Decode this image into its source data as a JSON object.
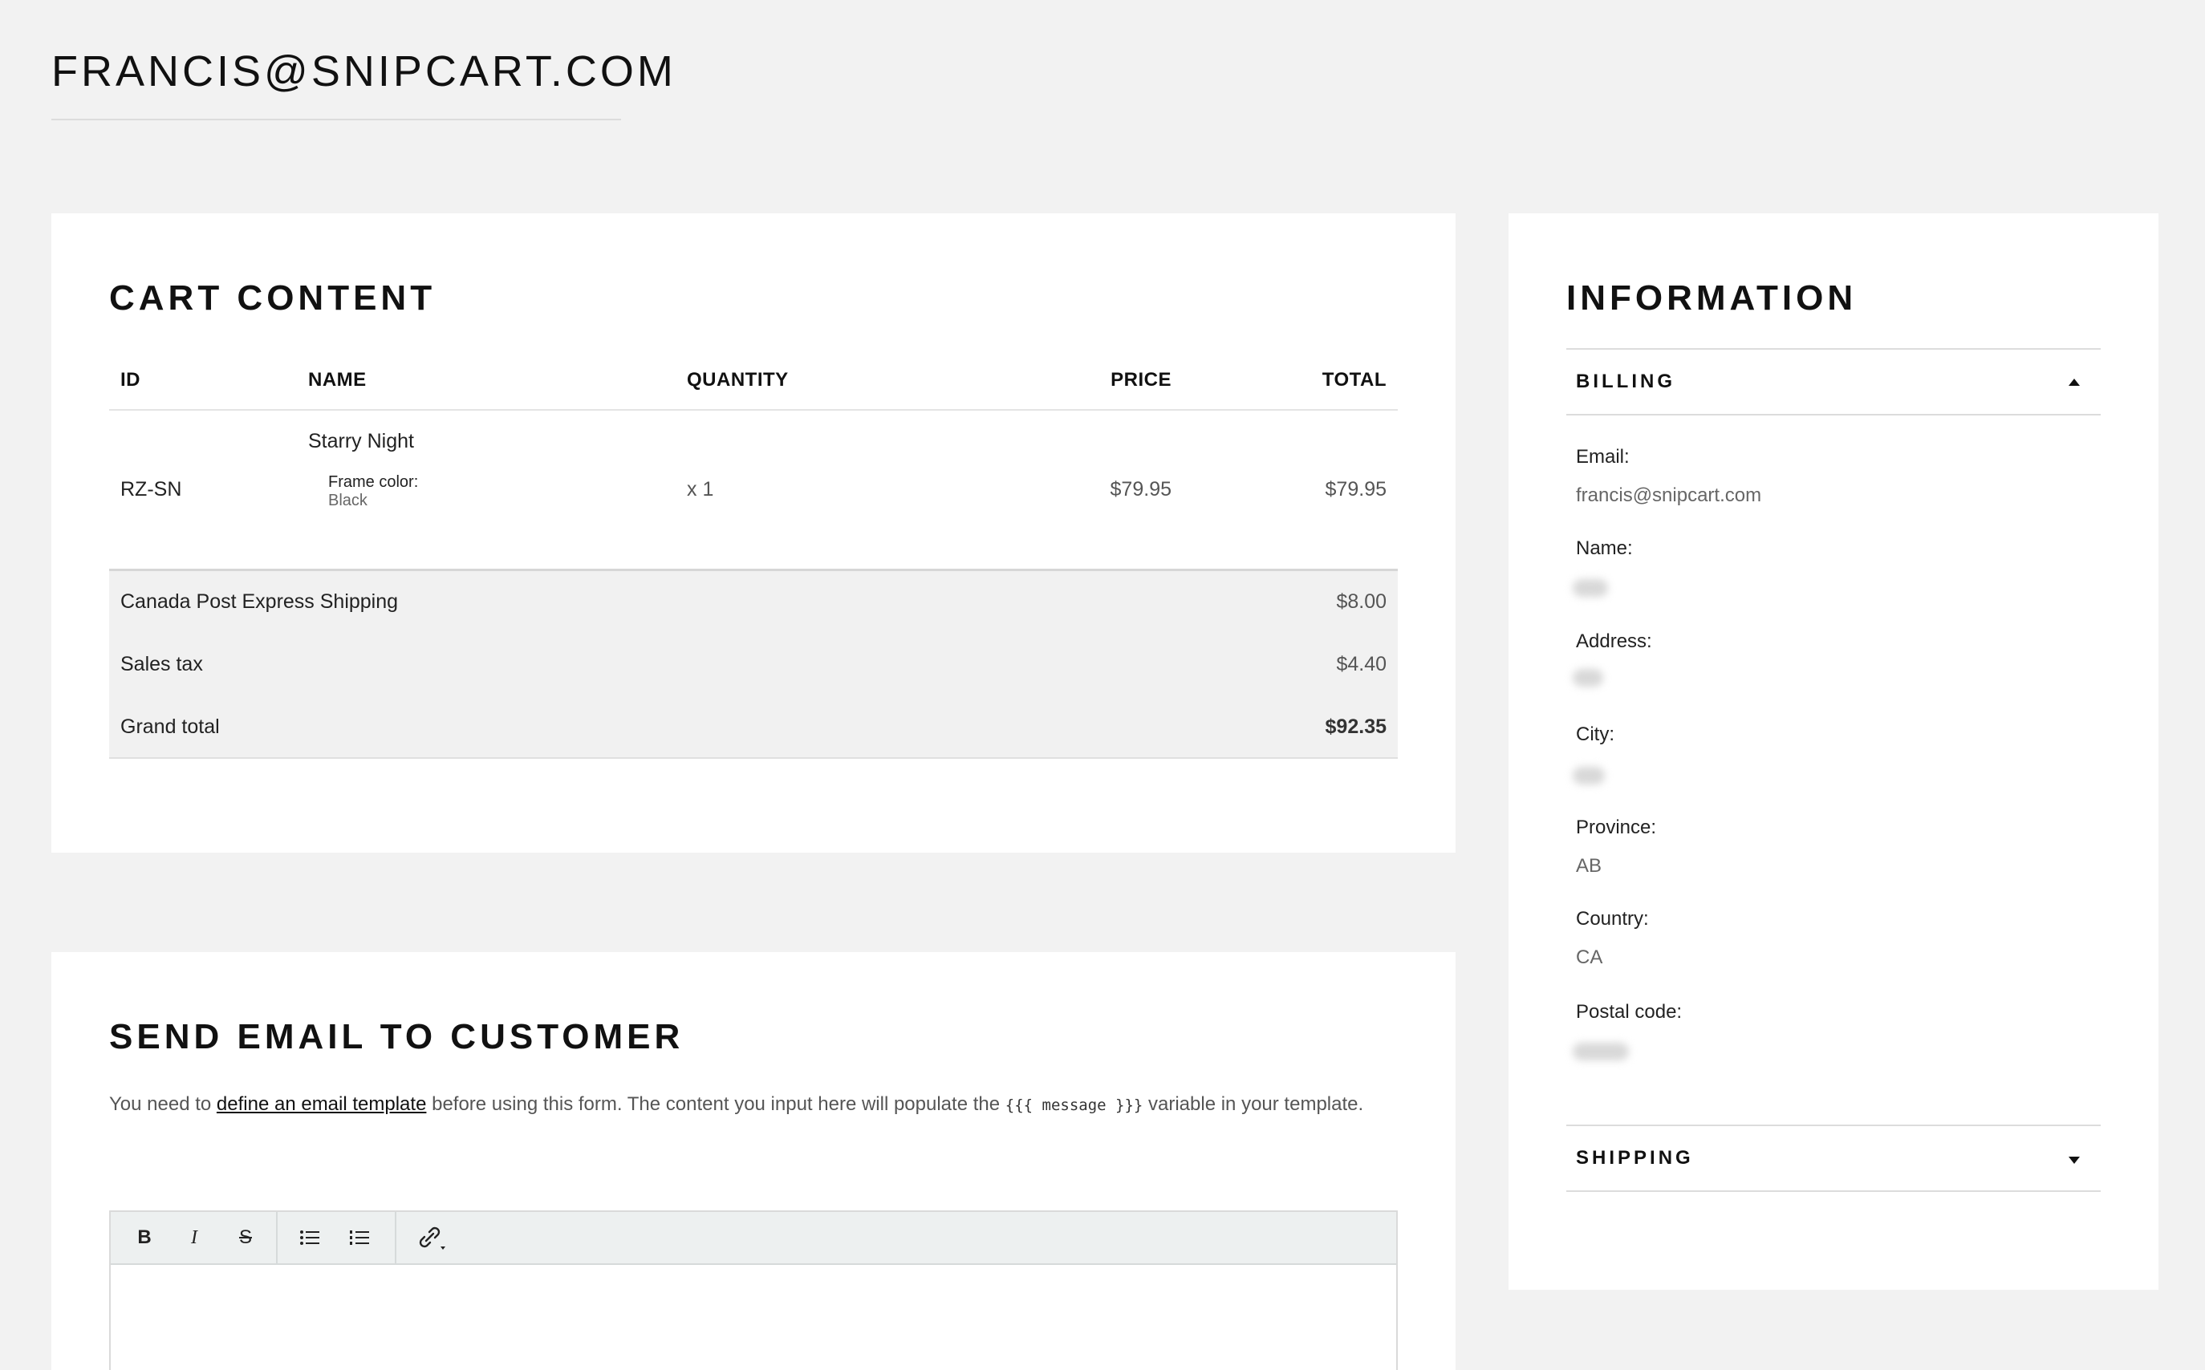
{
  "page": {
    "title": "FRANCIS@SNIPCART.COM"
  },
  "cart": {
    "title": "CART CONTENT",
    "columns": {
      "id": "ID",
      "name": "NAME",
      "quantity": "QUANTITY",
      "price": "PRICE",
      "total": "TOTAL"
    },
    "items": [
      {
        "id": "RZ-SN",
        "name": "Starry Night",
        "option_label": "Frame color:",
        "option_value": "Black",
        "quantity": "x 1",
        "price": "$79.95",
        "total": "$79.95"
      }
    ],
    "summary": {
      "shipping_label": "Canada Post Express Shipping",
      "shipping_value": "$8.00",
      "tax_label": "Sales tax",
      "tax_value": "$4.40",
      "grand_label": "Grand total",
      "grand_value": "$92.35"
    }
  },
  "email": {
    "title": "SEND EMAIL TO CUSTOMER",
    "desc_before": "You need to ",
    "desc_link": "define an email template",
    "desc_middle": " before using this form. The content you input here will populate the ",
    "desc_code": "{{{ message }}}",
    "desc_after": " variable in your template.",
    "toolbar": {
      "bold": "B",
      "italic": "I",
      "strike": "S"
    }
  },
  "info": {
    "title": "INFORMATION",
    "billing": {
      "title": "BILLING",
      "email_label": "Email:",
      "email_value": "francis@snipcart.com",
      "name_label": "Name:",
      "address_label": "Address:",
      "city_label": "City:",
      "province_label": "Province:",
      "province_value": "AB",
      "country_label": "Country:",
      "country_value": "CA",
      "postal_label": "Postal code:"
    },
    "shipping": {
      "title": "SHIPPING"
    }
  },
  "icons": {
    "bold": "bold-icon",
    "italic": "italic-icon",
    "strike": "strikethrough-icon",
    "bullet_list": "bullet-list-icon",
    "numbered_list": "numbered-list-icon",
    "link": "link-icon",
    "collapse": "caret-up-icon",
    "expand": "caret-down-icon"
  }
}
